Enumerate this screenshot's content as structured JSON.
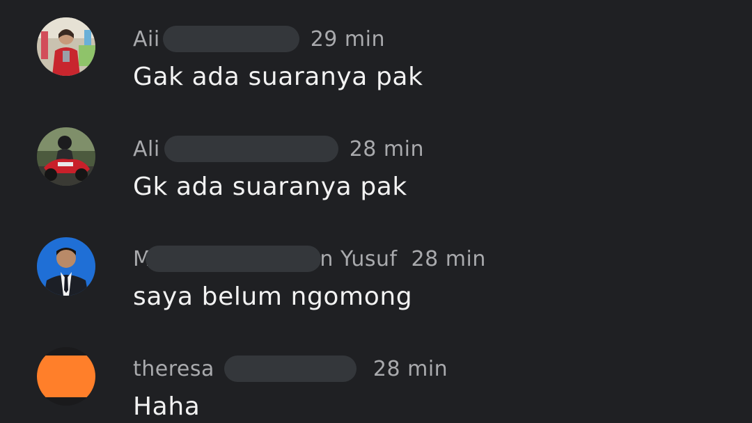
{
  "comments": [
    {
      "name": "Aii",
      "name_suffix": "",
      "time": "29 min",
      "message": "Gak ada suaranya pak",
      "avatar": "photo-girl-red-jacket"
    },
    {
      "name": "Ali",
      "name_suffix": "",
      "time": "28 min",
      "message": "Gk ada suaranya pak",
      "avatar": "photo-man-motorbike"
    },
    {
      "name": "M",
      "name_suffix": "n Yusuf",
      "time": "28 min",
      "message": "saya belum ngomong",
      "avatar": "photo-man-blue-background"
    },
    {
      "name": "theresa",
      "name_suffix": "",
      "time": "28 min",
      "message": "Haha",
      "avatar": "orange-circle"
    }
  ],
  "colors": {
    "background": "#1f2023",
    "name_text": "#a9aaad",
    "message_text": "#f2f2f2",
    "redaction": "#34373b",
    "orange_avatar": "#ff7f2a"
  }
}
